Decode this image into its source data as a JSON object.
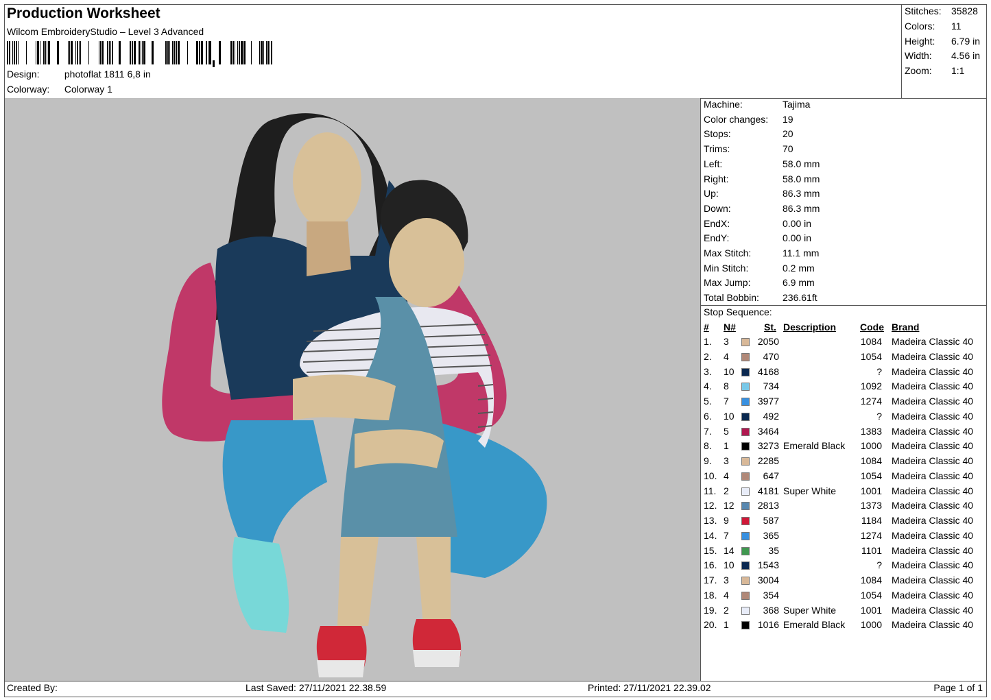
{
  "header": {
    "title": "Production Worksheet",
    "software": "Wilcom EmbroideryStudio – Level 3 Advanced",
    "barcode_icon": "barcode-icon",
    "design_label": "Design:",
    "design_value": "photoflat 1811 6,8 in",
    "colorway_label": "Colorway:",
    "colorway_value": "Colorway 1"
  },
  "summary": [
    {
      "label": "Stitches:",
      "value": "35828"
    },
    {
      "label": "Colors:",
      "value": "11"
    },
    {
      "label": "Height:",
      "value": "6.79 in"
    },
    {
      "label": "Width:",
      "value": "4.56 in"
    },
    {
      "label": "Zoom:",
      "value": "1:1"
    }
  ],
  "machine_info": [
    {
      "label": "Machine:",
      "value": "Tajima"
    },
    {
      "label": "Color changes:",
      "value": "19"
    },
    {
      "label": "Stops:",
      "value": "20"
    },
    {
      "label": "Trims:",
      "value": "70"
    },
    {
      "label": "Left:",
      "value": "58.0 mm"
    },
    {
      "label": "Right:",
      "value": "58.0 mm"
    },
    {
      "label": "Up:",
      "value": "86.3 mm"
    },
    {
      "label": "Down:",
      "value": "86.3 mm"
    },
    {
      "label": "EndX:",
      "value": "0.00 in"
    },
    {
      "label": "EndY:",
      "value": "0.00 in"
    },
    {
      "label": "Max Stitch:",
      "value": "11.1 mm"
    },
    {
      "label": "Min Stitch:",
      "value": "0.2 mm"
    },
    {
      "label": "Max Jump:",
      "value": "6.9 mm"
    },
    {
      "label": "Total Bobbin:",
      "value": "236.61ft"
    }
  ],
  "stop_sequence": {
    "title": "Stop Sequence:",
    "columns": {
      "idx": "#",
      "n": "N#",
      "st": "St.",
      "desc": "Description",
      "code": "Code",
      "brand": "Brand"
    },
    "rows": [
      {
        "idx": "1.",
        "n": "3",
        "color": "#d8b898",
        "st": "2050",
        "desc": "",
        "code": "1084",
        "brand": "Madeira Classic 40"
      },
      {
        "idx": "2.",
        "n": "4",
        "color": "#b08878",
        "st": "470",
        "desc": "",
        "code": "1054",
        "brand": "Madeira Classic 40"
      },
      {
        "idx": "3.",
        "n": "10",
        "color": "#0a2850",
        "st": "4168",
        "desc": "",
        "code": "?",
        "brand": "Madeira Classic 40"
      },
      {
        "idx": "4.",
        "n": "8",
        "color": "#78c8e8",
        "st": "734",
        "desc": "",
        "code": "1092",
        "brand": "Madeira Classic 40"
      },
      {
        "idx": "5.",
        "n": "7",
        "color": "#3890e0",
        "st": "3977",
        "desc": "",
        "code": "1274",
        "brand": "Madeira Classic 40"
      },
      {
        "idx": "6.",
        "n": "10",
        "color": "#0a2850",
        "st": "492",
        "desc": "",
        "code": "?",
        "brand": "Madeira Classic 40"
      },
      {
        "idx": "7.",
        "n": "5",
        "color": "#b01850",
        "st": "3464",
        "desc": "",
        "code": "1383",
        "brand": "Madeira Classic 40"
      },
      {
        "idx": "8.",
        "n": "1",
        "color": "#000000",
        "st": "3273",
        "desc": "Emerald Black",
        "code": "1000",
        "brand": "Madeira Classic 40"
      },
      {
        "idx": "9.",
        "n": "3",
        "color": "#d8b898",
        "st": "2285",
        "desc": "",
        "code": "1084",
        "brand": "Madeira Classic 40"
      },
      {
        "idx": "10.",
        "n": "4",
        "color": "#b08878",
        "st": "647",
        "desc": "",
        "code": "1054",
        "brand": "Madeira Classic 40"
      },
      {
        "idx": "11.",
        "n": "2",
        "color": "#e8ecf8",
        "st": "4181",
        "desc": "Super White",
        "code": "1001",
        "brand": "Madeira Classic 40"
      },
      {
        "idx": "12.",
        "n": "12",
        "color": "#5888b0",
        "st": "2813",
        "desc": "",
        "code": "1373",
        "brand": "Madeira Classic 40"
      },
      {
        "idx": "13.",
        "n": "9",
        "color": "#d01838",
        "st": "587",
        "desc": "",
        "code": "1184",
        "brand": "Madeira Classic 40"
      },
      {
        "idx": "14.",
        "n": "7",
        "color": "#3890e0",
        "st": "365",
        "desc": "",
        "code": "1274",
        "brand": "Madeira Classic 40"
      },
      {
        "idx": "15.",
        "n": "14",
        "color": "#409850",
        "st": "35",
        "desc": "",
        "code": "1101",
        "brand": "Madeira Classic 40"
      },
      {
        "idx": "16.",
        "n": "10",
        "color": "#0a2850",
        "st": "1543",
        "desc": "",
        "code": "?",
        "brand": "Madeira Classic 40"
      },
      {
        "idx": "17.",
        "n": "3",
        "color": "#d8b898",
        "st": "3004",
        "desc": "",
        "code": "1084",
        "brand": "Madeira Classic 40"
      },
      {
        "idx": "18.",
        "n": "4",
        "color": "#b08878",
        "st": "354",
        "desc": "",
        "code": "1054",
        "brand": "Madeira Classic 40"
      },
      {
        "idx": "19.",
        "n": "2",
        "color": "#e8ecf8",
        "st": "368",
        "desc": "Super White",
        "code": "1001",
        "brand": "Madeira Classic 40"
      },
      {
        "idx": "20.",
        "n": "1",
        "color": "#000000",
        "st": "1016",
        "desc": "Emerald Black",
        "code": "1000",
        "brand": "Madeira Classic 40"
      }
    ]
  },
  "footer": {
    "created_by": "Created By:",
    "last_saved": "Last Saved: 27/11/2021 22.38.59",
    "printed": "Printed: 27/11/2021 22.39.02",
    "page": "Page 1 of 1"
  },
  "colors": {
    "canvas_bg": "#c0c0c0",
    "hair": "#1e1e1e",
    "skin": "#d8c098",
    "sweater_sleeve": "#c03868",
    "vest_navy": "#1a3a5a",
    "jeans": "#3898c8",
    "overalls": "#5a90a8",
    "shirt_stripes": "#e8e8f0",
    "shoes_mint": "#78d8d8",
    "shoes_red": "#d02838"
  }
}
